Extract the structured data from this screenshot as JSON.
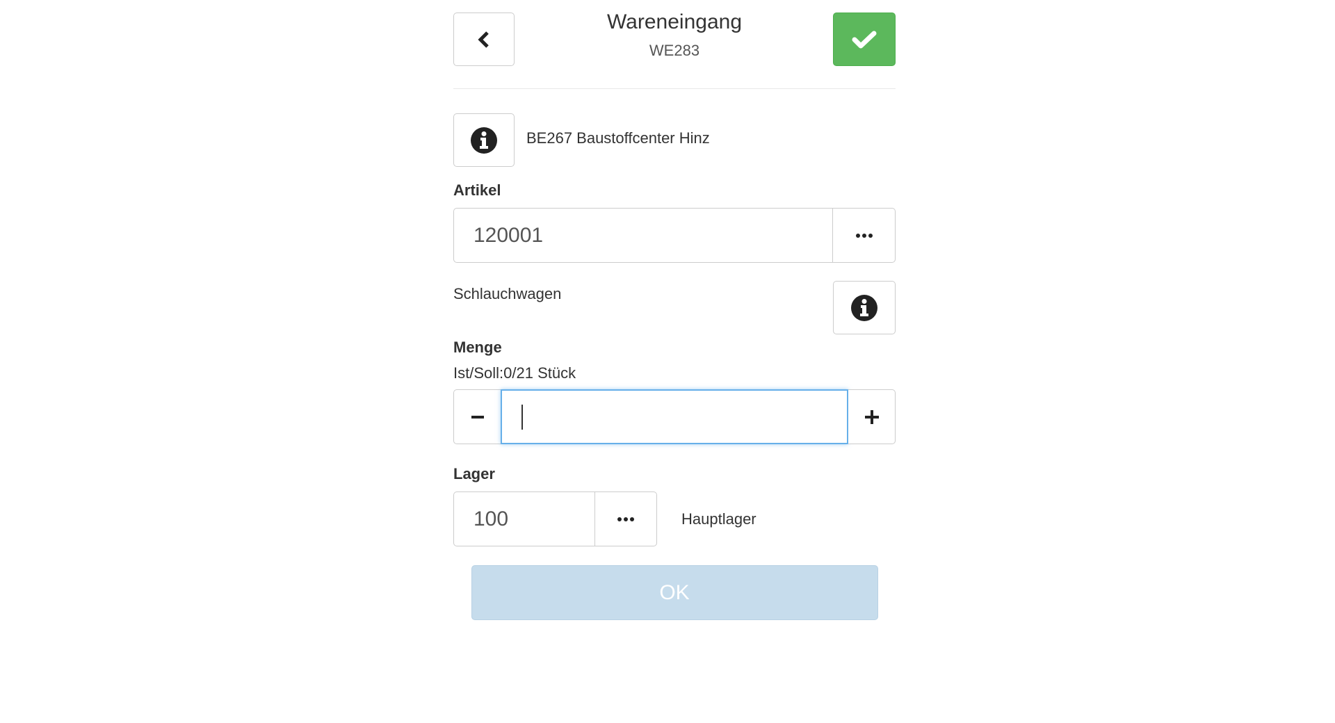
{
  "header": {
    "title": "Wareneingang",
    "subtitle": "WE283"
  },
  "order": {
    "info_text": "BE267 Baustoffcenter Hinz"
  },
  "artikel": {
    "label": "Artikel",
    "value": "120001",
    "lookup_label": "•••",
    "description": "Schlauchwagen"
  },
  "menge": {
    "label": "Menge",
    "hint": "Ist/Soll:0/21 Stück",
    "value": "",
    "minus_label": "−",
    "plus_label": "+"
  },
  "lager": {
    "label": "Lager",
    "value": "100",
    "lookup_label": "•••",
    "name": "Hauptlager"
  },
  "actions": {
    "ok_label": "OK"
  },
  "colors": {
    "confirm": "#5cb85c",
    "focus": "#66afe9",
    "ok_disabled": "#c6dcec"
  },
  "icons": {
    "back": "chevron-left-icon",
    "confirm": "check-icon",
    "info": "info-circle-icon",
    "lookup": "ellipsis-icon"
  }
}
